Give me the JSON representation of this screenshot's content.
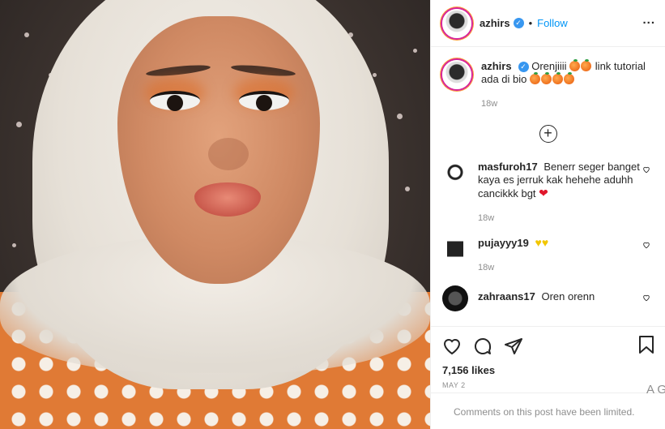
{
  "header": {
    "username": "azhirs",
    "separator": "•",
    "follow_label": "Follow",
    "more_label": "..."
  },
  "caption": {
    "username": "azhirs",
    "text_part1": "Orenjiiii",
    "text_part2": "link tutorial ada di bio",
    "time": "18w"
  },
  "load_more_symbol": "+",
  "comments": [
    {
      "username": "masfuroh17",
      "text": "Benerr seger banget kaya es jerruk kak hehehe aduhh cancikkk bgt",
      "emoji": "❤",
      "time": "18w"
    },
    {
      "username": "pujayyy19",
      "text": "",
      "emoji": "♥♥",
      "time": "18w"
    },
    {
      "username": "zahraans17",
      "text": "Oren orenn",
      "emoji": "",
      "time": ""
    }
  ],
  "actions": {
    "likes": "7,156 likes",
    "date": "MAY 2"
  },
  "footer": {
    "limited_text": "Comments on this post have been limited.",
    "clipped_right": "A G"
  },
  "colors": {
    "link_blue": "#0095f6",
    "verified_blue": "#3897f0",
    "muted": "#8e8e8e",
    "shirt_orange": "#e07a35"
  },
  "icons": [
    "verified-icon",
    "more-icon",
    "load-more-icon",
    "heart-icon",
    "comment-icon",
    "share-icon",
    "bookmark-icon"
  ]
}
